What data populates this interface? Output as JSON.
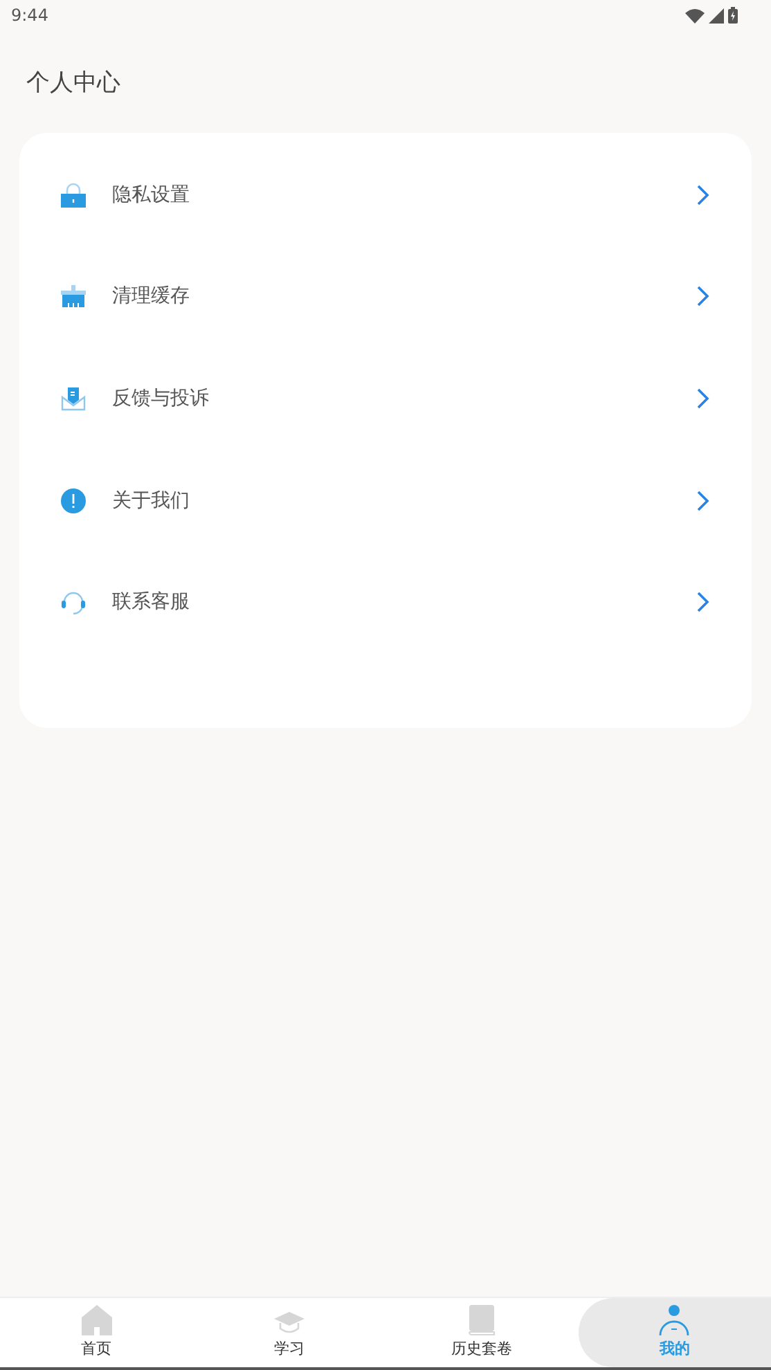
{
  "status_bar": {
    "time": "9:44"
  },
  "header": {
    "title": "个人中心"
  },
  "menu": [
    {
      "kind": "lock",
      "label": "隐私设置"
    },
    {
      "kind": "brush",
      "label": "清理缓存"
    },
    {
      "kind": "mail",
      "label": "反馈与投诉"
    },
    {
      "kind": "info",
      "label": "关于我们"
    },
    {
      "kind": "headset",
      "label": "联系客服"
    }
  ],
  "tabs": [
    {
      "kind": "home",
      "label": "首页",
      "selected": false
    },
    {
      "kind": "cap",
      "label": "学习",
      "selected": false
    },
    {
      "kind": "book",
      "label": "历史套卷",
      "selected": false
    },
    {
      "kind": "person",
      "label": "我的",
      "selected": true
    }
  ]
}
